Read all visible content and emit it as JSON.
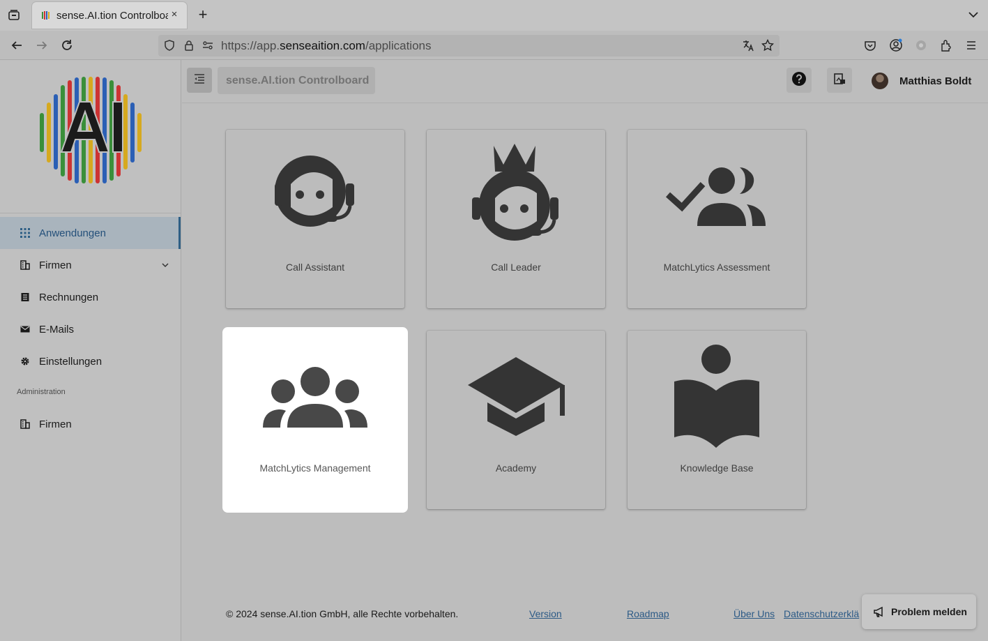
{
  "browser": {
    "tab_title": "sense.AI.tion Controlboard",
    "tab_close": "×",
    "new_tab": "+",
    "url_prefix": "https://app.",
    "url_domain": "senseaition.com",
    "url_path": "/applications"
  },
  "header": {
    "app_title": "sense.AI.tion Controlboard",
    "user_name": "Matthias Boldt"
  },
  "sidebar": {
    "items": [
      {
        "label": "Anwendungen",
        "icon": "grid-icon",
        "active": true
      },
      {
        "label": "Firmen",
        "icon": "building-icon",
        "expandable": true
      },
      {
        "label": "Rechnungen",
        "icon": "receipt-icon"
      },
      {
        "label": "E-Mails",
        "icon": "mail-icon"
      },
      {
        "label": "Einstellungen",
        "icon": "gear-icon"
      }
    ],
    "section_title": "Administration",
    "admin_items": [
      {
        "label": "Firmen",
        "icon": "building-icon"
      }
    ]
  },
  "apps": [
    {
      "label": "Call Assistant",
      "icon": "support-agent-icon"
    },
    {
      "label": "Call Leader",
      "icon": "crowned-agent-icon"
    },
    {
      "label": "MatchLytics Assessment",
      "icon": "people-check-icon"
    },
    {
      "label": "MatchLytics Management",
      "icon": "groups-icon",
      "highlighted": true
    },
    {
      "label": "Academy",
      "icon": "graduation-cap-icon"
    },
    {
      "label": "Knowledge Base",
      "icon": "reading-person-icon"
    }
  ],
  "footer": {
    "copyright": "© 2024 sense.AI.tion GmbH, alle Rechte vorbehalten.",
    "links": [
      "Version",
      "Roadmap",
      "Über Uns",
      "Datenschutzerklä"
    ]
  },
  "problem_button": {
    "label": "Problem melden"
  },
  "colors": {
    "active_accent": "#2e5f85",
    "link": "#2c5a86",
    "icon_dark": "#333333"
  }
}
